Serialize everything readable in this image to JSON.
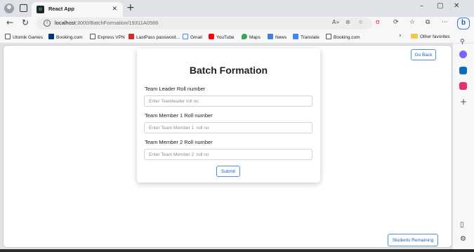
{
  "browser": {
    "tab": {
      "title": "React App",
      "favicon": "react-icon"
    },
    "url": {
      "host": "localhost",
      "path": ":3000/BatchFormation/19311A0566"
    },
    "bookmarks": [
      {
        "label": "Utomik Games",
        "icon": "page-icon"
      },
      {
        "label": "Booking.com",
        "icon": "booking-icon",
        "color": "#003580"
      },
      {
        "label": "Express VPN",
        "icon": "page-icon"
      },
      {
        "label": "LastPass password...",
        "icon": "lastpass-icon",
        "color": "#d32d27"
      },
      {
        "label": "Gmail",
        "icon": "google-icon"
      },
      {
        "label": "YouTube",
        "icon": "youtube-icon",
        "color": "#ff0000"
      },
      {
        "label": "Maps",
        "icon": "maps-icon"
      },
      {
        "label": "News",
        "icon": "news-icon"
      },
      {
        "label": "Translate",
        "icon": "translate-icon"
      },
      {
        "label": "Booking.com",
        "icon": "page-icon"
      }
    ],
    "other_favorites": "Other favorites",
    "accent_color": "#1b5fb5"
  },
  "page": {
    "go_back": "Go Back",
    "students_remaining": "Students Remaining",
    "form": {
      "title": "Batch Formation",
      "fields": [
        {
          "label": "Team Leader Roll number",
          "placeholder": "Enter Teamleader roll no"
        },
        {
          "label": "Team Member 1 Roll number",
          "placeholder": "Enter Team Member 1  roll no"
        },
        {
          "label": "Team Member 2 Roll number",
          "placeholder": "Enter Team Member 2  roll no"
        }
      ],
      "submit": "Submit"
    }
  }
}
